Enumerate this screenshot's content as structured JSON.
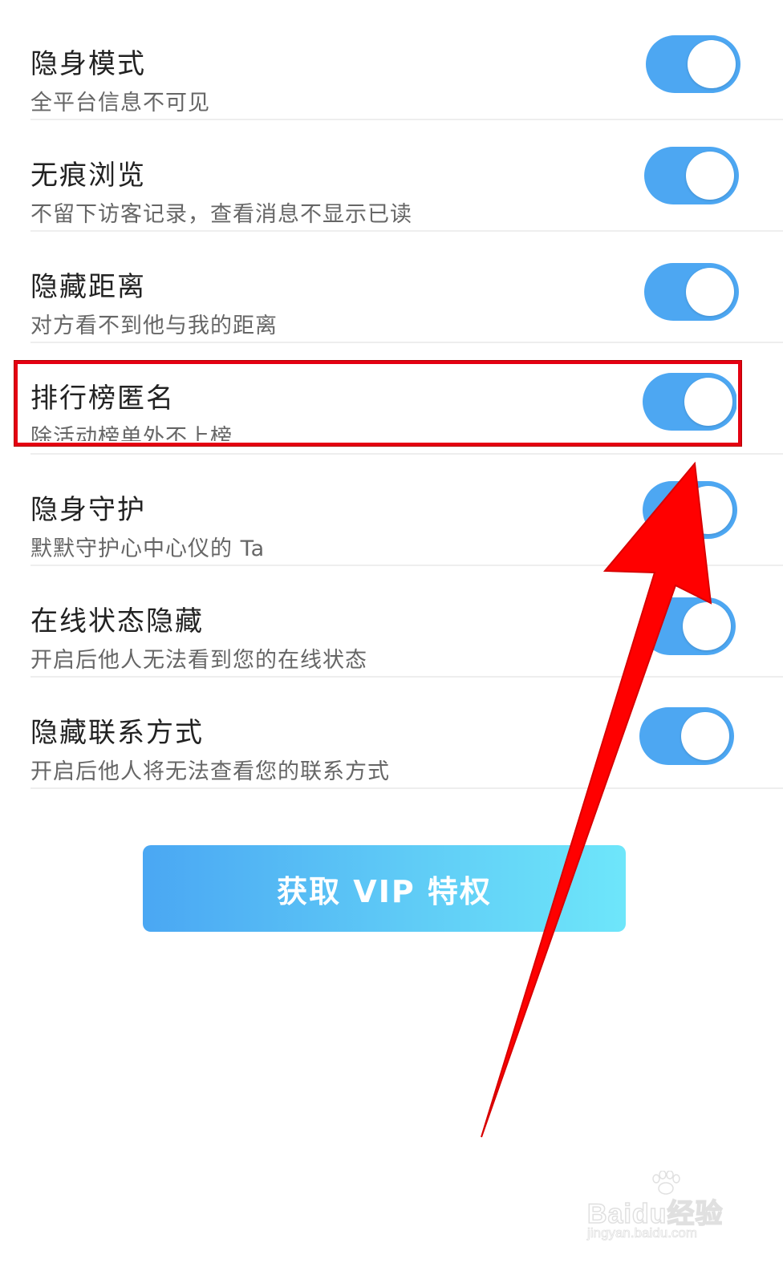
{
  "settings": [
    {
      "title": "隐身模式",
      "description": "全平台信息不可见",
      "enabled": true
    },
    {
      "title": "无痕浏览",
      "description": "不留下访客记录，查看消息不显示已读",
      "enabled": true
    },
    {
      "title": "隐藏距离",
      "description": "对方看不到他与我的距离",
      "enabled": true
    },
    {
      "title": "排行榜匿名",
      "description": "除活动榜单外不上榜",
      "enabled": true
    },
    {
      "title": "隐身守护",
      "description": "默默守护心中心仪的 Ta",
      "enabled": true
    },
    {
      "title": "在线状态隐藏",
      "description": "开启后他人无法看到您的在线状态",
      "enabled": true
    },
    {
      "title": "隐藏联系方式",
      "description": "开启后他人将无法查看您的联系方式",
      "enabled": true
    }
  ],
  "vip_button": {
    "label": "获取 VIP 特权"
  },
  "colors": {
    "toggle_on": "#4da7f2",
    "highlight": "#e50012",
    "arrow": "#ff0000",
    "button_gradient_start": "#4aa7f3",
    "button_gradient_end": "#6ee6fa"
  },
  "watermark": {
    "brand": "Baidu经验",
    "site": "jingyan.baidu.com"
  }
}
